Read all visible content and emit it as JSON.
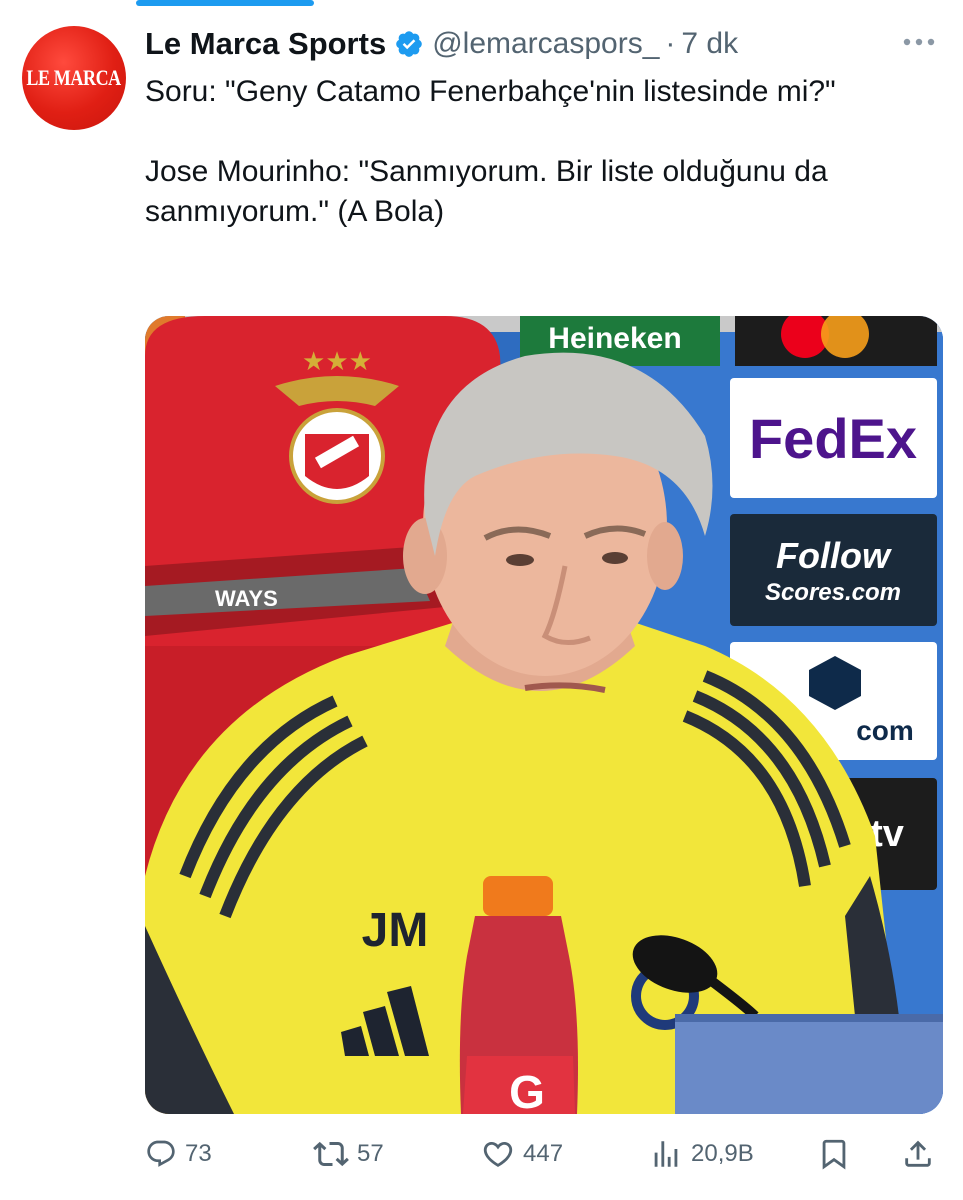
{
  "account": {
    "avatar_text": "LE MARCA",
    "display_name": "Le Marca Sports",
    "handle": "@lemarcaspors_",
    "separator": "·",
    "time_ago": "7 dk"
  },
  "tweet": {
    "paragraphs": [
      "Soru: \"Geny Catamo Fenerbahçe'nin listesinde mi?\"",
      "Jose Mourinho: \"Sanmıyorum. Bir liste olduğunu da sanmıyorum.\" (A Bola)"
    ]
  },
  "media": {
    "sponsor_brands": [
      "Heineken",
      "FedEx",
      "Follow",
      "Scores.com",
      "com",
      "tv",
      "WAYS"
    ],
    "shirt_logo": "JM",
    "bottle_brand": "G"
  },
  "actions": {
    "reply_count": "73",
    "repost_count": "57",
    "like_count": "447",
    "views_count": "20,9B"
  },
  "colors": {
    "accent": "#1d9bf0",
    "secondary_text": "#536471",
    "primary_text": "#0f1419",
    "avatar_bg": "#e01f14",
    "shirt_yellow": "#f5ec3a",
    "chair_red": "#d9232e"
  },
  "icons": [
    "verified-badge-icon",
    "more-icon",
    "reply-icon",
    "repost-icon",
    "like-icon",
    "views-icon",
    "bookmark-icon",
    "share-icon"
  ]
}
